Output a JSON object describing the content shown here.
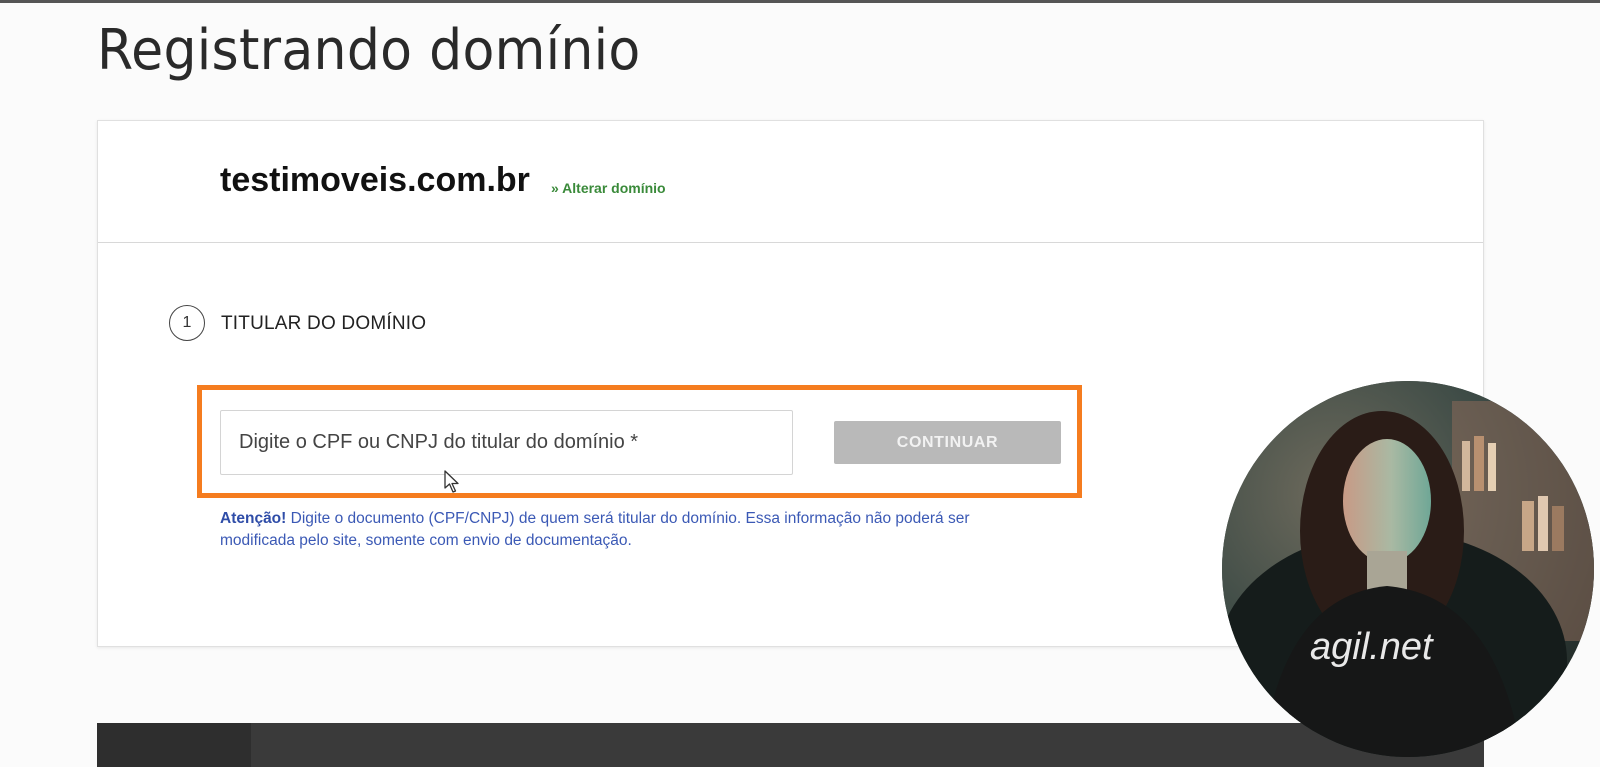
{
  "page": {
    "title": "Registrando domínio"
  },
  "domain": {
    "name": "testimoveis.com.br",
    "change_link": "» Alterar domínio"
  },
  "step": {
    "number": "1",
    "label": "TITULAR DO DOMÍNIO"
  },
  "document_field": {
    "placeholder": "Digite o CPF ou CNPJ do titular do domínio *",
    "value": ""
  },
  "continue_button": {
    "label": "CONTINUAR",
    "enabled": false
  },
  "notice": {
    "strong": "Atenção!",
    "text": " Digite o documento (CPF/CNPJ) de quem será titular do domínio. Essa informação não poderá ser modificada pelo site, somente com envio de documentação."
  },
  "overlay": {
    "shirt_text": "agil.net"
  },
  "colors": {
    "highlight": "#f57c1f",
    "link_green": "#3a8a3a",
    "notice_blue": "#3b59b5",
    "button_disabled": "#b9b9b9"
  },
  "icons": [
    "cursor-arrow-icon",
    "step-number-icon"
  ]
}
